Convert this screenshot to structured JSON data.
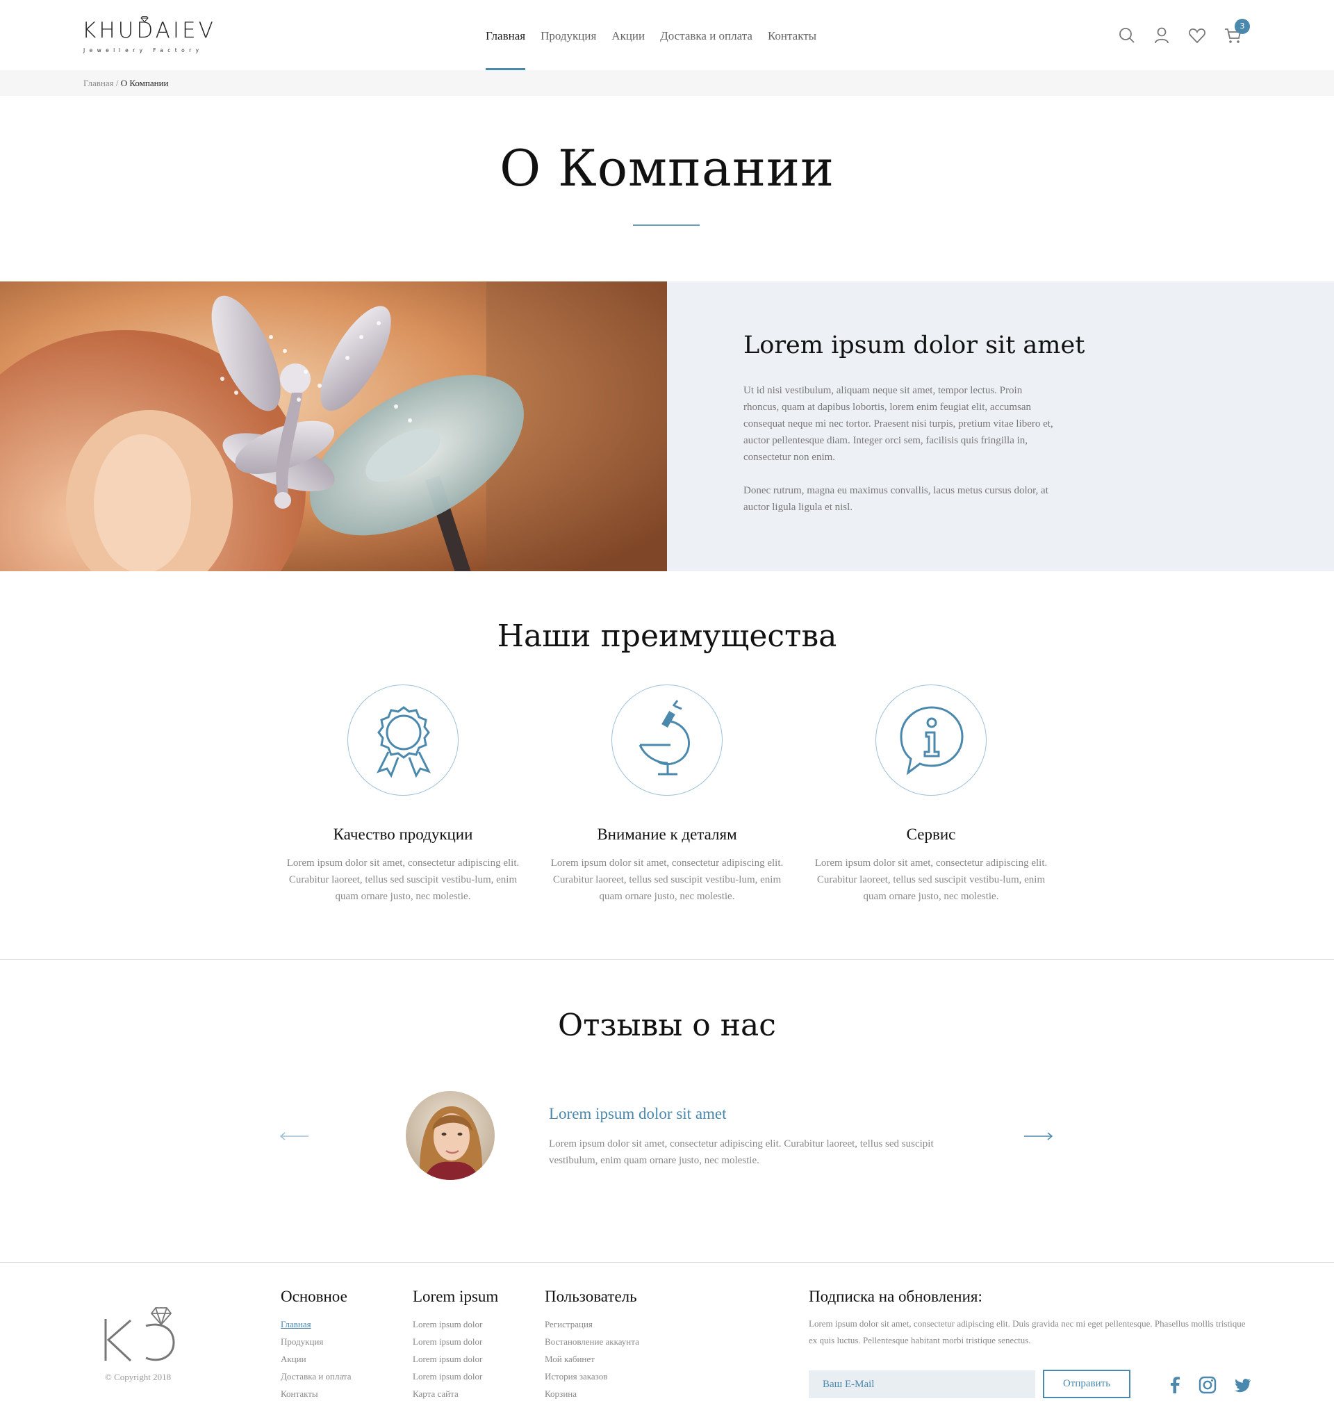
{
  "header": {
    "logo_text": "KHUDAIEV",
    "logo_subtitle": "Jewellery Factory",
    "nav": [
      {
        "label": "Главная"
      },
      {
        "label": "Продукция"
      },
      {
        "label": "Акции"
      },
      {
        "label": "Доставка и оплата"
      },
      {
        "label": "Контакты"
      }
    ],
    "cart_count": "3",
    "icons": [
      "search-icon",
      "user-icon",
      "heart-icon",
      "cart-icon"
    ]
  },
  "breadcrumb": {
    "home": "Главная",
    "separator": " / ",
    "current": "О Компании"
  },
  "page_title": "О Компании",
  "about": {
    "heading": "Lorem ipsum dolor sit amet",
    "paragraph1": "Ut id nisi vestibulum, aliquam neque sit amet, tempor lectus. Proin rhoncus, quam at dapibus lobortis, lorem enim feugiat elit, accumsan consequat neque mi nec tortor. Praesent nisi turpis, pretium vitae libero et, auctor pellentesque diam. Integer orci sem, facilisis quis fringilla in, consectetur non enim.",
    "paragraph2": "Donec rutrum, magna eu maximus convallis, lacus metus cursus dolor, at auctor ligula ligula et nisl."
  },
  "advantages": {
    "title": "Наши преимущества",
    "items": [
      {
        "name": "Качество продукции",
        "desc": "Lorem ipsum dolor sit amet, consectetur adipiscing elit. Curabitur laoreet, tellus sed suscipit vestibu-lum, enim quam ornare justo, nec molestie.",
        "icon": "award-icon"
      },
      {
        "name": "Внимание к деталям",
        "desc": "Lorem ipsum dolor sit amet, consectetur adipiscing elit. Curabitur laoreet, tellus sed suscipit vestibu-lum, enim quam ornare justo, nec molestie.",
        "icon": "microscope-icon"
      },
      {
        "name": "Сервис",
        "desc": "Lorem ipsum dolor sit amet, consectetur adipiscing elit. Curabitur laoreet, tellus sed suscipit vestibu-lum, enim quam ornare justo, nec molestie.",
        "icon": "info-bubble-icon"
      }
    ]
  },
  "reviews": {
    "title": "Отзывы о нас",
    "name": "Lorem ipsum dolor sit amet",
    "text": "Lorem ipsum dolor sit amet, consectetur adipiscing elit. Curabitur laoreet, tellus sed suscipit vestibulum, enim quam ornare justo, nec molestie."
  },
  "footer": {
    "copyright": "© Copyright 2018",
    "columns": [
      {
        "title": "Основное",
        "links": [
          "Главная",
          "Продукция",
          "Акции",
          "Доставка и оплата",
          "Контакты"
        ]
      },
      {
        "title": "Lorem ipsum",
        "links": [
          "Lorem ipsum dolor",
          "Lorem ipsum dolor",
          "Lorem ipsum dolor",
          "Lorem ipsum dolor",
          "Карта сайта"
        ]
      },
      {
        "title": "Пользователь",
        "links": [
          "Регистрация",
          "Востановление аккаунта",
          "Мой кабинет",
          "История заказов",
          "Корзина"
        ]
      }
    ],
    "subscribe": {
      "title": "Подписка на обновления:",
      "text": "Lorem ipsum dolor sit amet, consectetur adipiscing elit. Duis gravida nec mi eget pellentesque. Phasellus mollis tristique ex quis luctus. Pellentesque habitant morbi tristique senectus.",
      "placeholder": "Ваш E-Mail",
      "button": "Отправить"
    },
    "social": [
      "facebook-icon",
      "instagram-icon",
      "twitter-icon"
    ]
  },
  "colors": {
    "accent": "#4b88ad",
    "panel_bg": "#edf1f5",
    "breadcrumb_bg": "#f6f6f6"
  }
}
